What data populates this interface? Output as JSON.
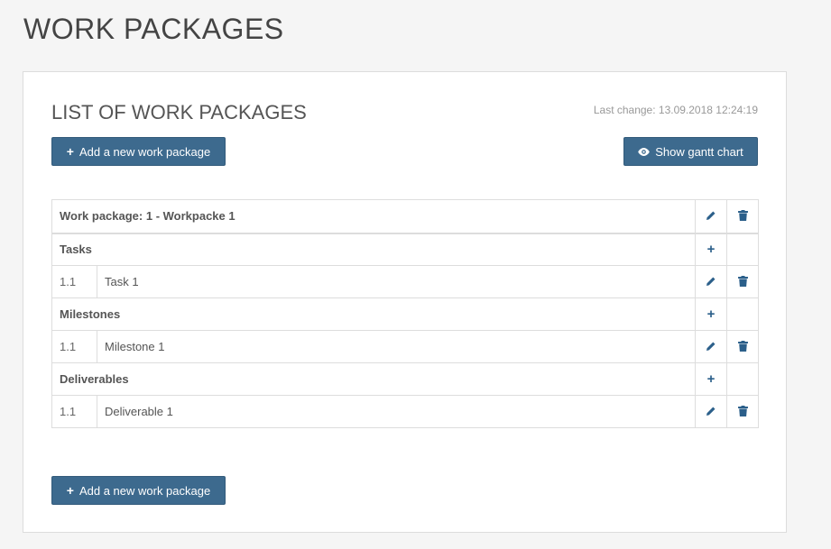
{
  "page": {
    "title": "WORK PACKAGES"
  },
  "panel": {
    "title": "LIST OF WORK PACKAGES",
    "last_change": "Last change: 13.09.2018 12:24:19"
  },
  "buttons": {
    "add_work_package": "Add a new work package",
    "show_gantt": "Show gantt chart"
  },
  "colors": {
    "accent": "#3d6a8e",
    "icon": "#2b5f8a"
  },
  "work_package": {
    "title": "Work package: 1 - Workpacke 1",
    "sections": [
      {
        "name": "Tasks",
        "items": [
          {
            "num": "1.1",
            "label": "Task 1"
          }
        ]
      },
      {
        "name": "Milestones",
        "items": [
          {
            "num": "1.1",
            "label": "Milestone 1"
          }
        ]
      },
      {
        "name": "Deliverables",
        "items": [
          {
            "num": "1.1",
            "label": "Deliverable 1"
          }
        ]
      }
    ]
  },
  "icons": {
    "edit": "pencil-icon",
    "delete": "trash-icon",
    "add": "plus-icon",
    "view": "eye-icon"
  }
}
